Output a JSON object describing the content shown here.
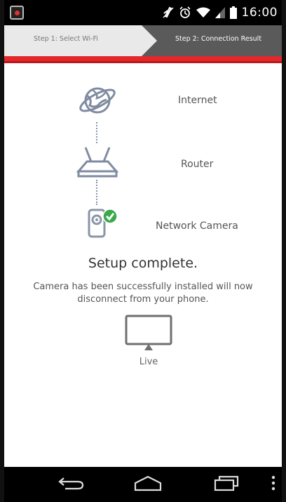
{
  "status_bar": {
    "time": "16:00",
    "icons": [
      "app-notification-icon",
      "mute-icon",
      "alarm-icon",
      "wifi-icon",
      "signal-icon",
      "battery-icon"
    ]
  },
  "steps": {
    "step1_label": "Step 1: Select Wi-Fi",
    "step2_label": "Step 2: Connection Result",
    "active_step": 2
  },
  "diagram": {
    "internet_label": "Internet",
    "router_label": "Router",
    "camera_label": "Network Camera"
  },
  "result": {
    "title": "Setup complete.",
    "message": "Camera has been successfully installed will now disconnect from your phone."
  },
  "live": {
    "label": "Live"
  },
  "colors": {
    "accent_red": "#e5262b",
    "icon_blue": "#7f8ba0",
    "success_green": "#3aa94a",
    "step_active_bg": "#5a5a5a",
    "step_inactive_bg": "#e9e9e9"
  },
  "nav_bar": {
    "icons": [
      "back-icon",
      "home-icon",
      "recent-apps-icon",
      "menu-icon"
    ]
  }
}
